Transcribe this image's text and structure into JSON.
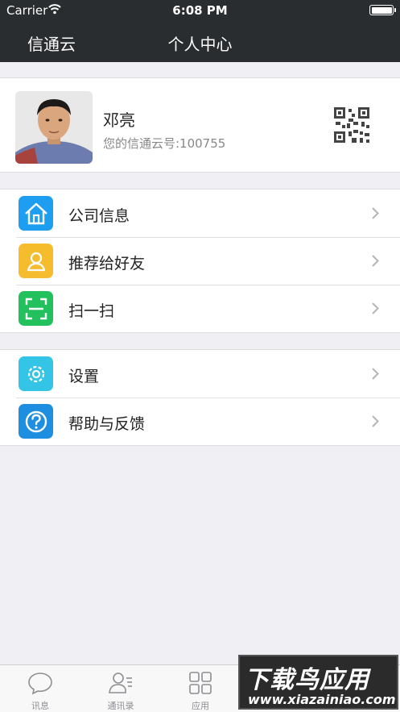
{
  "status_bar": {
    "carrier": "Carrier",
    "time": "6:08 PM"
  },
  "nav": {
    "left": "信通云",
    "title": "个人中心"
  },
  "profile": {
    "name": "邓亮",
    "id_text": "您的信通云号:100755"
  },
  "groups": [
    {
      "items": [
        {
          "label": "公司信息",
          "icon": "house-icon",
          "color": "#1e9ef0"
        },
        {
          "label": "推荐给好友",
          "icon": "person-icon",
          "color": "#f5bd2e"
        },
        {
          "label": "扫一扫",
          "icon": "scan-icon",
          "color": "#22c15e"
        }
      ]
    },
    {
      "items": [
        {
          "label": "设置",
          "icon": "gear-icon",
          "color": "#33c4e6"
        },
        {
          "label": "帮助与反馈",
          "icon": "help-icon",
          "color": "#1e8fe0"
        }
      ]
    }
  ],
  "tabs": [
    {
      "label": "讯息",
      "icon": "chat-bubble-icon"
    },
    {
      "label": "通讯录",
      "icon": "contacts-icon"
    },
    {
      "label": "应用",
      "icon": "apps-grid-icon"
    }
  ],
  "watermark": {
    "big": "下载鸟应用",
    "small": "www.xiazainiao.com"
  }
}
